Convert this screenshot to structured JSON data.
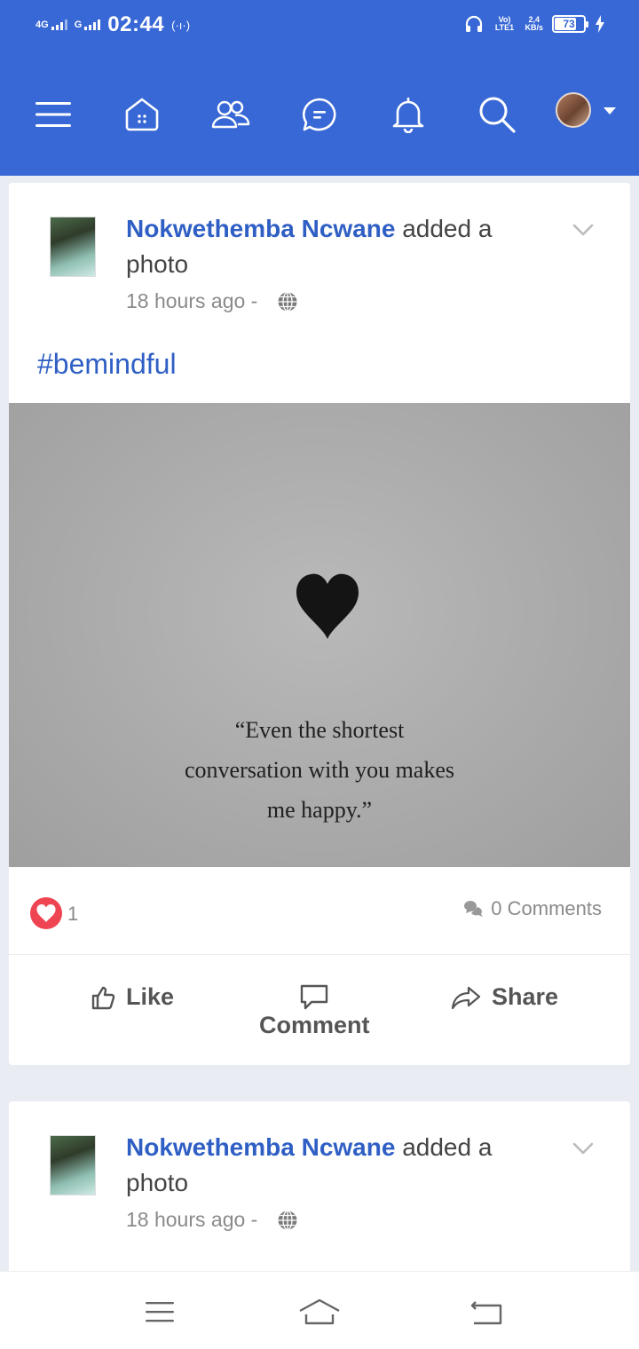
{
  "status_bar": {
    "network_left": "4G",
    "network_right": "G",
    "time": "02:44",
    "volte": "Vo) LTE1",
    "speed_value": "2,4",
    "speed_unit": "KB/s",
    "battery": "73"
  },
  "nav": {
    "icons": [
      "menu-icon",
      "home-icon",
      "friends-icon",
      "messages-icon",
      "notifications-icon",
      "search-icon"
    ],
    "profile": "profile-avatar"
  },
  "posts": [
    {
      "author": "Nokwethemba Ncwane",
      "action": " added a photo",
      "time": "18 hours ago -",
      "hashtag": "#bemindful",
      "quote_lines": [
        "“Even the shortest",
        "conversation with you makes",
        "me happy.”"
      ],
      "reactions": "1",
      "comments": "0 Comments",
      "actions": {
        "like": "Like",
        "comment": "Comment",
        "share": "Share"
      }
    },
    {
      "author": "Nokwethemba Ncwane",
      "action": " added a photo",
      "time": "18 hours ago -"
    }
  ],
  "colors": {
    "brand": "#3868d6",
    "link": "#2f5fc4",
    "reaction": "#ef4452"
  }
}
